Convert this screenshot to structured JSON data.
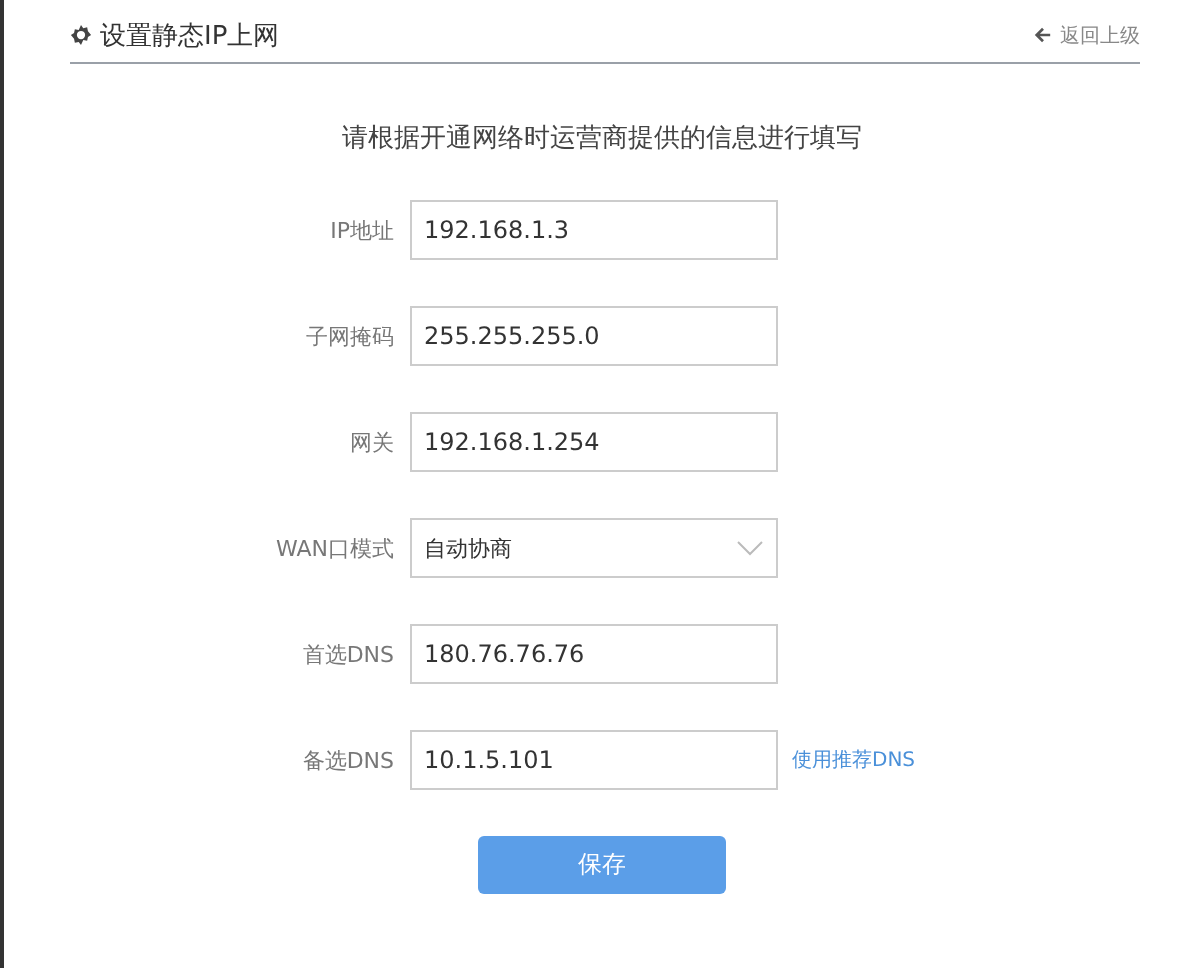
{
  "header": {
    "title": "设置静态IP上网",
    "back_link": "返回上级"
  },
  "instruction": "请根据开通网络时运营商提供的信息进行填写",
  "fields": [
    {
      "kind": "input",
      "label": "IP地址",
      "value": "192.168.1.3"
    },
    {
      "kind": "input",
      "label": "子网掩码",
      "value": "255.255.255.0"
    },
    {
      "kind": "input",
      "label": "网关",
      "value": "192.168.1.254"
    },
    {
      "kind": "select",
      "label": "WAN口模式",
      "value": "自动协商"
    },
    {
      "kind": "input",
      "label": "首选DNS",
      "value": "180.76.76.76"
    },
    {
      "kind": "input",
      "label": "备选DNS",
      "value": "10.1.5.101",
      "link": "使用推荐DNS"
    }
  ],
  "save_button": "保存"
}
